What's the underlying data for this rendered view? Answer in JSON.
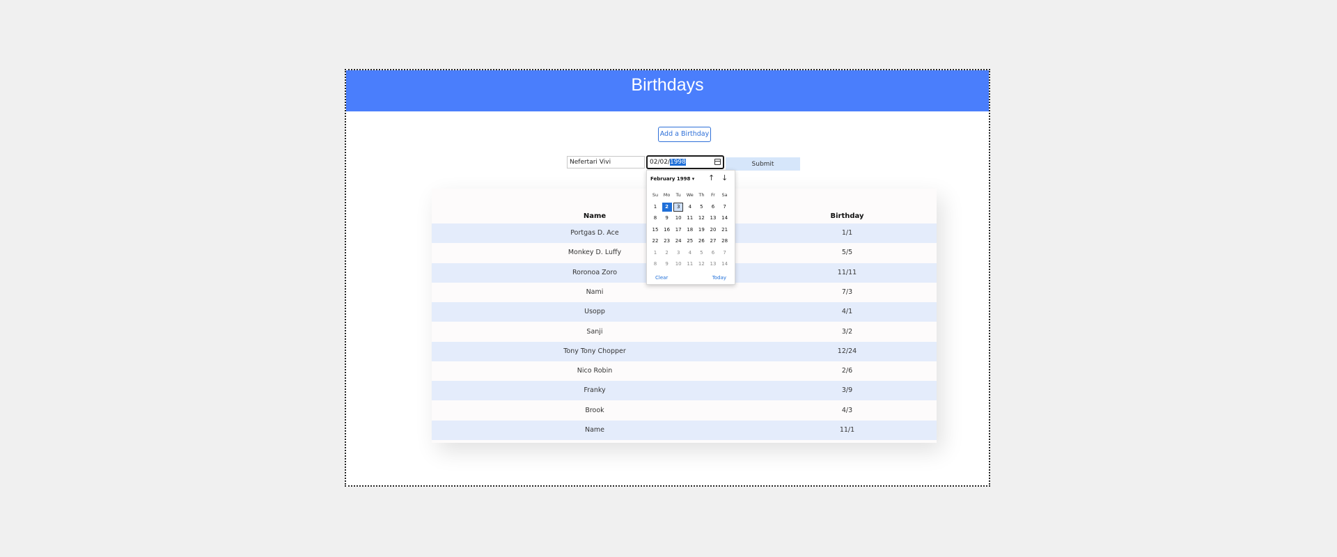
{
  "header": {
    "title": "Birthdays"
  },
  "add_button": {
    "label": "Add a Birthday"
  },
  "form": {
    "name_value": "Nefertari Vivi",
    "date_prefix": "02/02/",
    "date_selected": "1998",
    "submit_label": "Submit"
  },
  "table": {
    "headers": {
      "name": "Name",
      "birthday": "Birthday"
    },
    "rows": [
      {
        "name": "Portgas D. Ace",
        "birthday": "1/1"
      },
      {
        "name": "Monkey D. Luffy",
        "birthday": "5/5"
      },
      {
        "name": "Roronoa Zoro",
        "birthday": "11/11"
      },
      {
        "name": "Nami",
        "birthday": "7/3"
      },
      {
        "name": "Usopp",
        "birthday": "4/1"
      },
      {
        "name": "Sanji",
        "birthday": "3/2"
      },
      {
        "name": "Tony Tony Chopper",
        "birthday": "12/24"
      },
      {
        "name": "Nico Robin",
        "birthday": "2/6"
      },
      {
        "name": "Franky",
        "birthday": "3/9"
      },
      {
        "name": "Brook",
        "birthday": "4/3"
      },
      {
        "name": "Name",
        "birthday": "11/1"
      }
    ]
  },
  "picker": {
    "month_label": "February 1998 ▾",
    "up_arrow": "↑",
    "down_arrow": "↓",
    "weekdays": [
      "Su",
      "Mo",
      "Tu",
      "We",
      "Th",
      "Fr",
      "Sa"
    ],
    "weeks": [
      [
        "1",
        "2",
        "3",
        "4",
        "5",
        "6",
        "7"
      ],
      [
        "8",
        "9",
        "10",
        "11",
        "12",
        "13",
        "14"
      ],
      [
        "15",
        "16",
        "17",
        "18",
        "19",
        "20",
        "21"
      ],
      [
        "22",
        "23",
        "24",
        "25",
        "26",
        "27",
        "28"
      ],
      [
        "1",
        "2",
        "3",
        "4",
        "5",
        "6",
        "7"
      ],
      [
        "8",
        "9",
        "10",
        "11",
        "12",
        "13",
        "14"
      ]
    ],
    "current_month_weeks": 4,
    "selected_day": "2",
    "focused_day": "3",
    "clear_label": "Clear",
    "today_label": "Today"
  }
}
